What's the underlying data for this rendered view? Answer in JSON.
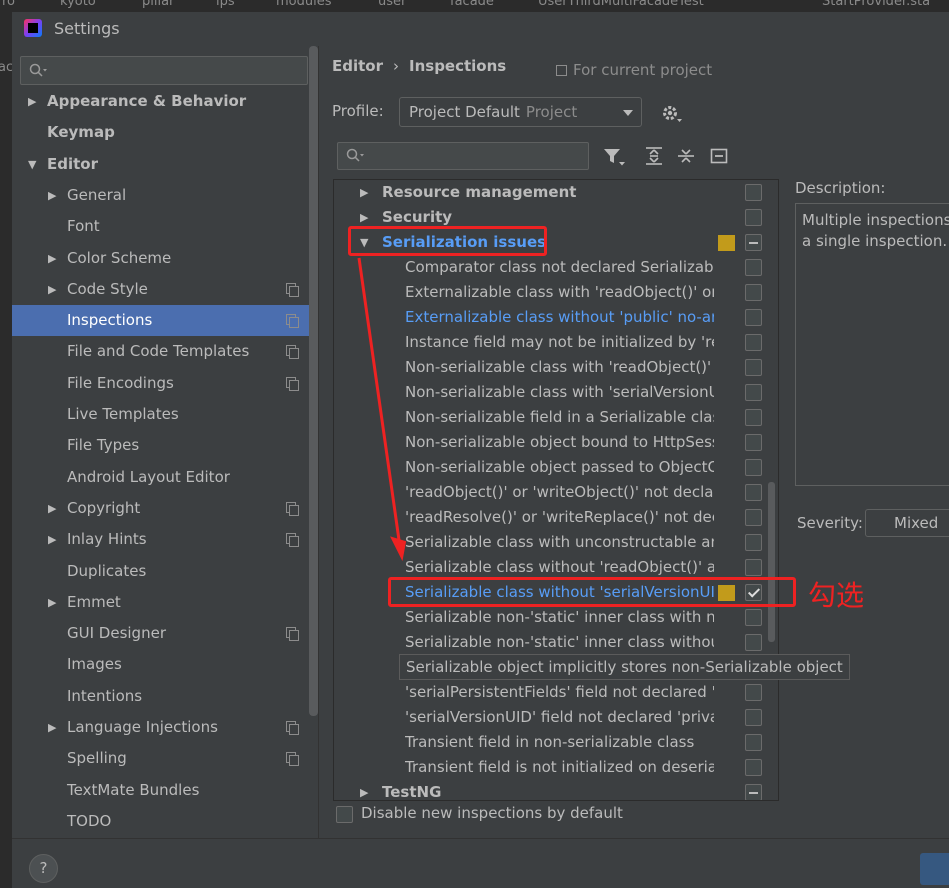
{
  "background_tabs": [
    {
      "label": "ro"
    },
    {
      "label": "kyoto"
    },
    {
      "label": "pillar"
    },
    {
      "label": "ips"
    },
    {
      "label": "modules"
    },
    {
      "label": "user"
    },
    {
      "label": "facade"
    },
    {
      "label": "UserThirdMultiFacadeTest"
    },
    {
      "label": "StartProvider.sta"
    }
  ],
  "left_edge_text": "ac",
  "window": {
    "title": "Settings",
    "icon": "intellij-icon"
  },
  "sidebar": {
    "search_placeholder": "",
    "items": [
      {
        "label": "Appearance & Behavior",
        "expandable": true,
        "expanded": false,
        "bold": true,
        "level": 0,
        "project_icon": false
      },
      {
        "label": "Keymap",
        "expandable": false,
        "bold": true,
        "level": 0,
        "project_icon": false
      },
      {
        "label": "Editor",
        "expandable": true,
        "expanded": true,
        "bold": true,
        "level": 0,
        "project_icon": false
      },
      {
        "label": "General",
        "expandable": true,
        "expanded": false,
        "level": 1,
        "project_icon": false
      },
      {
        "label": "Font",
        "expandable": false,
        "level": 1,
        "project_icon": false
      },
      {
        "label": "Color Scheme",
        "expandable": true,
        "expanded": false,
        "level": 1,
        "project_icon": false
      },
      {
        "label": "Code Style",
        "expandable": true,
        "expanded": false,
        "level": 1,
        "project_icon": true
      },
      {
        "label": "Inspections",
        "expandable": false,
        "level": 1,
        "project_icon": true,
        "selected": true
      },
      {
        "label": "File and Code Templates",
        "expandable": false,
        "level": 1,
        "project_icon": true
      },
      {
        "label": "File Encodings",
        "expandable": false,
        "level": 1,
        "project_icon": true
      },
      {
        "label": "Live Templates",
        "expandable": false,
        "level": 1,
        "project_icon": false
      },
      {
        "label": "File Types",
        "expandable": false,
        "level": 1,
        "project_icon": false
      },
      {
        "label": "Android Layout Editor",
        "expandable": false,
        "level": 1,
        "project_icon": false
      },
      {
        "label": "Copyright",
        "expandable": true,
        "expanded": false,
        "level": 1,
        "project_icon": true
      },
      {
        "label": "Inlay Hints",
        "expandable": true,
        "expanded": false,
        "level": 1,
        "project_icon": true
      },
      {
        "label": "Duplicates",
        "expandable": false,
        "level": 1,
        "project_icon": false
      },
      {
        "label": "Emmet",
        "expandable": true,
        "expanded": false,
        "level": 1,
        "project_icon": false
      },
      {
        "label": "GUI Designer",
        "expandable": false,
        "level": 1,
        "project_icon": true
      },
      {
        "label": "Images",
        "expandable": false,
        "level": 1,
        "project_icon": false
      },
      {
        "label": "Intentions",
        "expandable": false,
        "level": 1,
        "project_icon": false
      },
      {
        "label": "Language Injections",
        "expandable": true,
        "expanded": false,
        "level": 1,
        "project_icon": true
      },
      {
        "label": "Spelling",
        "expandable": false,
        "level": 1,
        "project_icon": true
      },
      {
        "label": "TextMate Bundles",
        "expandable": false,
        "level": 1,
        "project_icon": false
      },
      {
        "label": "TODO",
        "expandable": false,
        "level": 1,
        "project_icon": false
      }
    ]
  },
  "breadcrumb": {
    "parent": "Editor",
    "separator": "›",
    "current": "Inspections"
  },
  "for_current_project": "For current project",
  "profile": {
    "label": "Profile:",
    "value": "Project Default",
    "scope": "Project"
  },
  "inspections": {
    "search_placeholder": "",
    "rows": [
      {
        "label": "Resource management",
        "category": true,
        "expanded": false,
        "state": "unchecked"
      },
      {
        "label": "Security",
        "category": true,
        "expanded": false,
        "state": "unchecked"
      },
      {
        "label": "Serialization issues",
        "category": true,
        "expanded": true,
        "state": "mixed",
        "link": true,
        "severity_marker": true
      },
      {
        "label": "Comparator class not declared Serializable",
        "state": "unchecked"
      },
      {
        "label": "Externalizable class with 'readObject()' or 'v",
        "state": "unchecked"
      },
      {
        "label": "Externalizable class without 'public' no-arg",
        "state": "unchecked",
        "link": true
      },
      {
        "label": "Instance field may not be initialized by 'rea",
        "state": "unchecked"
      },
      {
        "label": "Non-serializable class with 'readObject()' o",
        "state": "unchecked"
      },
      {
        "label": "Non-serializable class with 'serialVersionUI",
        "state": "unchecked"
      },
      {
        "label": "Non-serializable field in a Serializable class",
        "state": "unchecked"
      },
      {
        "label": "Non-serializable object bound to HttpSess",
        "state": "unchecked"
      },
      {
        "label": "Non-serializable object passed to ObjectO",
        "state": "unchecked"
      },
      {
        "label": "'readObject()' or 'writeObject()' not declar",
        "state": "unchecked"
      },
      {
        "label": "'readResolve()' or 'writeReplace()' not decl",
        "state": "unchecked"
      },
      {
        "label": "Serializable class with unconstructable anc",
        "state": "unchecked"
      },
      {
        "label": "Serializable class without 'readObject()' and",
        "state": "unchecked"
      },
      {
        "label": "Serializable class without 'serialVersionUID",
        "state": "checked",
        "link": true,
        "severity_marker": true
      },
      {
        "label": "Serializable non-'static' inner class with nor",
        "state": "unchecked"
      },
      {
        "label": "Serializable non-'static' inner class without",
        "state": "unchecked"
      },
      {
        "label": "Serializable object implicitly stores non-Serializable object",
        "state": "none"
      },
      {
        "label": "'serialPersistentFields' field not declared 'p",
        "state": "unchecked"
      },
      {
        "label": "'serialVersionUID' field not declared 'privat",
        "state": "unchecked"
      },
      {
        "label": "Transient field in non-serializable class",
        "state": "unchecked"
      },
      {
        "label": "Transient field is not initialized on deseriali",
        "state": "unchecked"
      },
      {
        "label": "TestNG",
        "category": true,
        "expanded": false,
        "state": "mixed"
      }
    ],
    "tooltip": "Serializable object implicitly stores non-Serializable object"
  },
  "description": {
    "label": "Description:",
    "text_line1": "Multiple inspections",
    "text_line2": "a single inspection."
  },
  "severity": {
    "label": "Severity:",
    "value": "Mixed"
  },
  "disable_new": {
    "label": "Disable new inspections by default",
    "checked": false
  },
  "help_label": "?",
  "annotation": {
    "text": "勾选",
    "color": "#ee2222"
  },
  "colors": {
    "selection": "#4b6eaf",
    "link": "#589df6",
    "severity": "#c29b1b",
    "background": "#3c3f41"
  }
}
